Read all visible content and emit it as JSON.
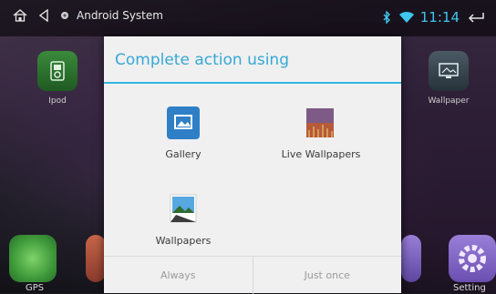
{
  "status_bar": {
    "title": "Android System",
    "time": "11:14",
    "icons": [
      "home-icon",
      "back-icon",
      "android-notification-icon",
      "bluetooth-icon",
      "wifi-icon",
      "return-icon"
    ]
  },
  "home": {
    "apps": [
      {
        "label": "Ipod",
        "icon": "ipod-icon"
      },
      {
        "label": "Wallpaper",
        "icon": "wallpaper-app-icon"
      }
    ],
    "dock": [
      {
        "label": "GPS",
        "icon": "gps-icon"
      },
      {
        "label": "Setting",
        "icon": "setting-gear-icon"
      }
    ]
  },
  "dialog": {
    "title": "Complete action using",
    "options": [
      {
        "label": "Gallery",
        "icon": "gallery-icon"
      },
      {
        "label": "Live Wallpapers",
        "icon": "live-wallpapers-icon"
      },
      {
        "label": "Wallpapers",
        "icon": "wallpapers-icon"
      }
    ],
    "buttons": {
      "always": "Always",
      "just_once": "Just once"
    }
  },
  "colors": {
    "accent": "#33b5e5",
    "dialog_bg": "#f0f0f0"
  }
}
